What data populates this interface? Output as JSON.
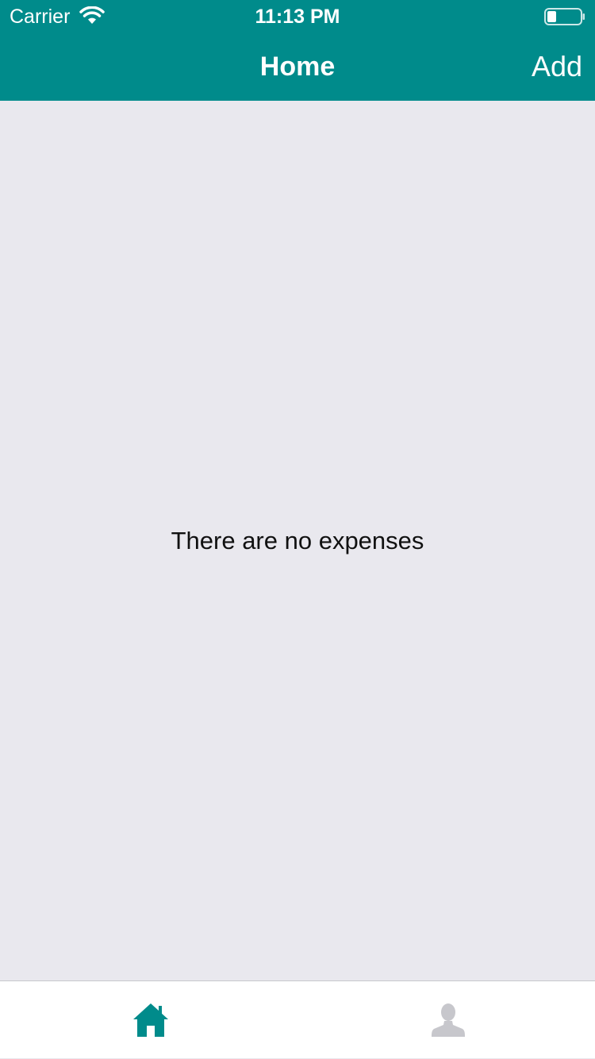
{
  "status_bar": {
    "carrier": "Carrier",
    "time": "11:13 PM",
    "icons": [
      "wifi-icon",
      "battery-icon"
    ]
  },
  "nav": {
    "title": "Home",
    "add_label": "Add"
  },
  "main": {
    "empty_message": "There are no expenses"
  },
  "tabbar": {
    "tabs": [
      {
        "icon": "home-icon",
        "active": true
      },
      {
        "icon": "person-icon",
        "active": false
      }
    ]
  },
  "colors": {
    "brand": "#008B8B",
    "background": "#E9E8EE",
    "tab_active": "#008B8B",
    "tab_inactive": "#C7C7CC"
  }
}
